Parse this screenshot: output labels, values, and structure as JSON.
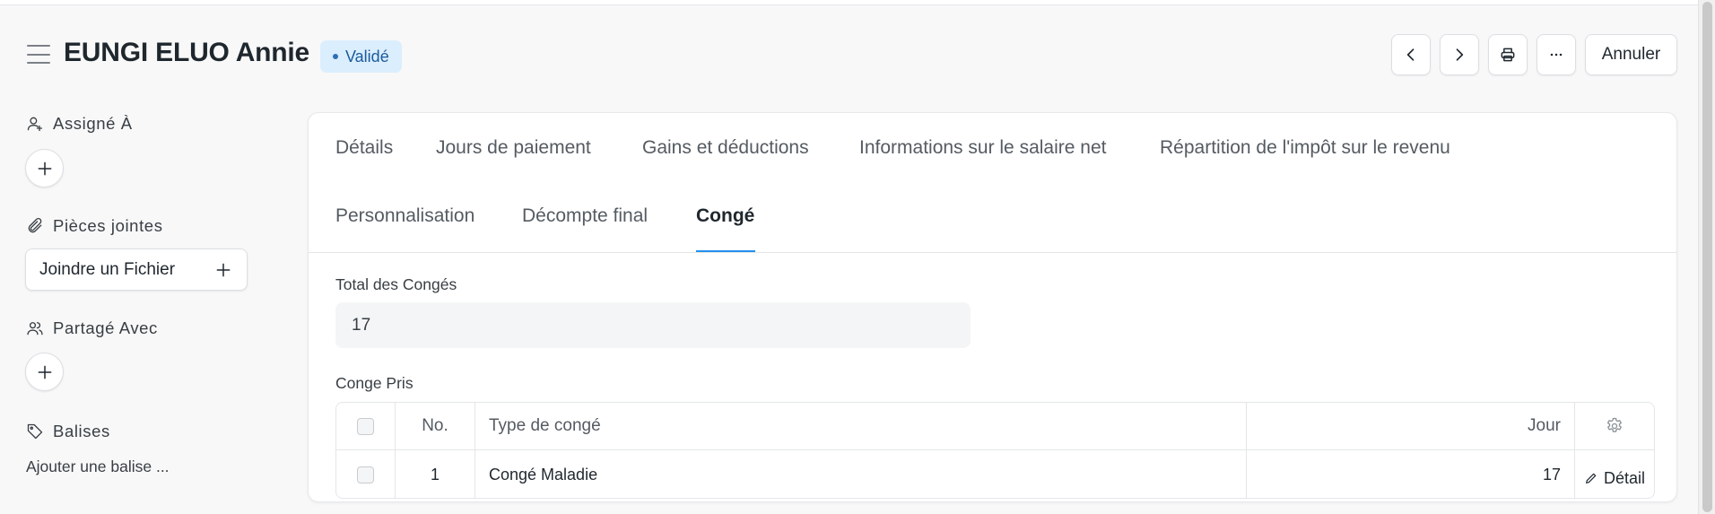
{
  "header": {
    "title": "EUNGI ELUO Annie",
    "status": "Validé",
    "cancel_label": "Annuler",
    "status_color": "#dbeefd",
    "icons": [
      "menu-icon",
      "chevron-left-icon",
      "chevron-right-icon",
      "printer-icon",
      "more-horizontal-icon"
    ]
  },
  "sidebar": {
    "assigned_label": "Assigné À",
    "attachments_label": "Pièces jointes",
    "attach_button": "Joindre un Fichier",
    "shared_label": "Partagé Avec",
    "tags_label": "Balises",
    "add_tag": "Ajouter une balise ..."
  },
  "tabs": [
    {
      "label": "Détails"
    },
    {
      "label": "Jours de paiement"
    },
    {
      "label": "Gains et déductions"
    },
    {
      "label": "Informations sur le salaire net"
    },
    {
      "label": "Répartition de l'impôt sur le revenu"
    },
    {
      "label": "Personnalisation"
    },
    {
      "label": "Décompte final"
    },
    {
      "label": "Congé",
      "active": true
    }
  ],
  "form": {
    "total_label": "Total des Congés",
    "total_value": "17",
    "taken_label": "Conge Pris"
  },
  "table": {
    "columns": [
      "No.",
      "Type de congé",
      "Jour"
    ],
    "rows": [
      {
        "no": "1",
        "type": "Congé Maladie",
        "days": "17",
        "action": "Détail"
      }
    ]
  },
  "accent_color": "#2490ef"
}
